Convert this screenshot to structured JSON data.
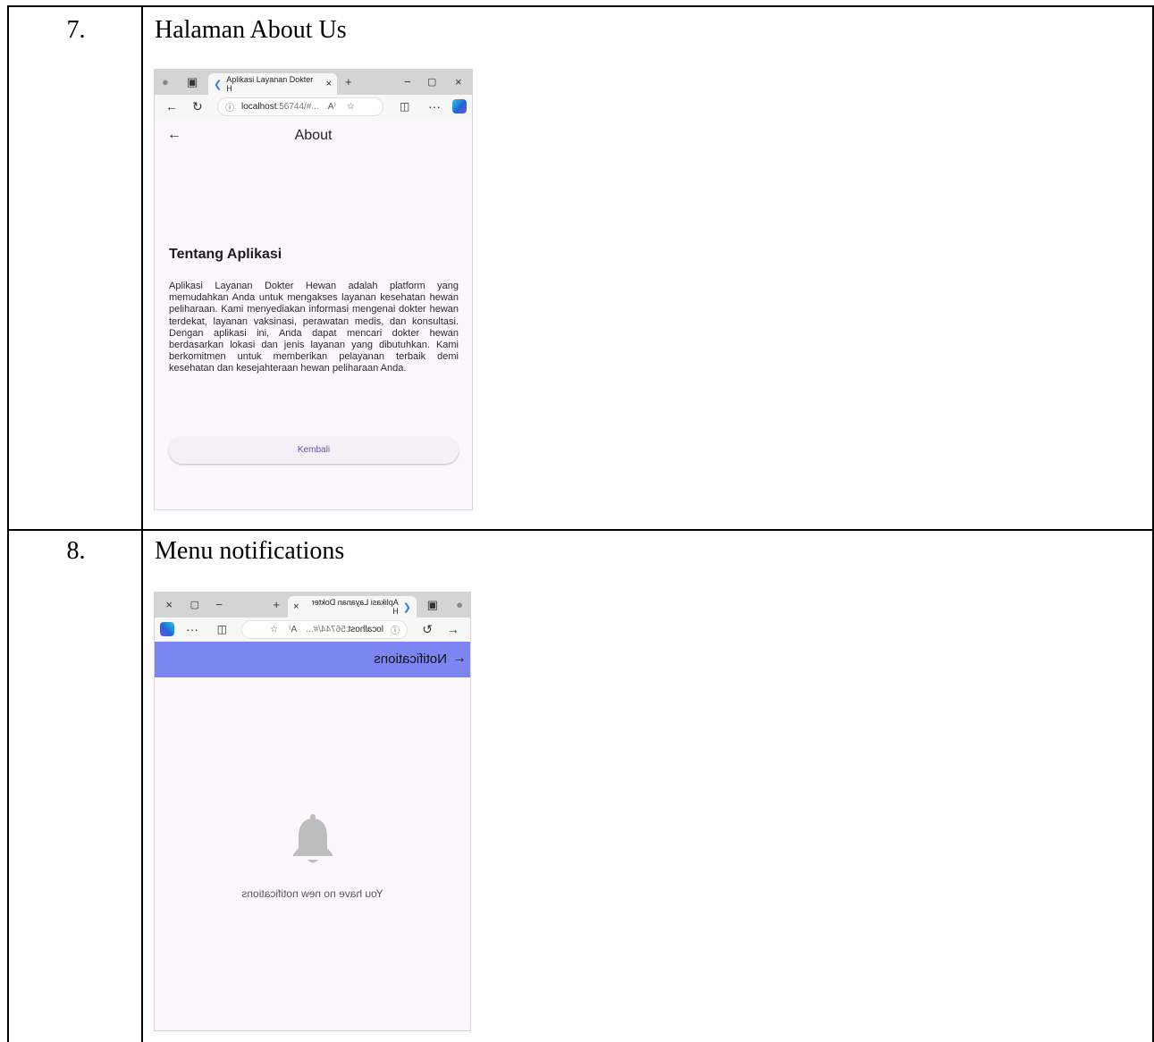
{
  "rows": [
    {
      "number": "7.",
      "title": "Halaman About Us",
      "screenshot": {
        "tab_title": "Aplikasi Layanan Dokter H",
        "url_host": "localhost",
        "url_rest": ":56744/#...",
        "page_title": "About",
        "heading": "Tentang Aplikasi",
        "description": "Aplikasi Layanan Dokter Hewan adalah platform yang memudahkan Anda untuk mengakses layanan kesehatan hewan peliharaan. Kami menyediakan informasi mengenai dokter hewan terdekat, layanan vaksinasi, perawatan medis, dan konsultasi. Dengan aplikasi ini, Anda dapat mencari dokter hewan berdasarkan lokasi dan jenis layanan yang dibutuhkan. Kami berkomitmen untuk memberikan pelayanan terbaik demi kesehatan dan kesejahteraan hewan peliharaan Anda.",
        "button_label": "Kembali"
      }
    },
    {
      "number": "8.",
      "title": "Menu notifications",
      "screenshot": {
        "tab_title": "Aplikasi Layanan Dokter H",
        "url_host": "localhost",
        "url_rest": ":56744/#...",
        "page_title": "Notifications",
        "empty_message": "You have no new notifications",
        "appbar_color": "#7c86f2"
      }
    }
  ],
  "browser_icons": {
    "close": "×",
    "minimize": "−",
    "maximize": "▢",
    "new_tab": "+",
    "back": "←",
    "refresh": "↻",
    "info": "ⓘ",
    "read_aloud": "A⁾",
    "favorite": "☆",
    "split": "◫",
    "more": "···"
  }
}
